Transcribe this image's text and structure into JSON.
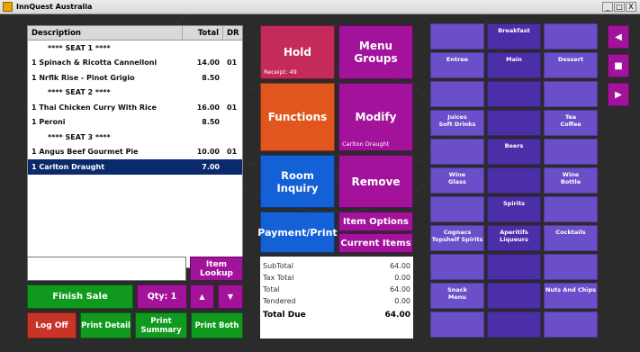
{
  "window": {
    "title": "InnQuest Australia",
    "controls": [
      "_",
      "□",
      "X"
    ]
  },
  "order": {
    "headers": {
      "description": "Description",
      "total": "Total",
      "dr": "DR"
    },
    "rows": [
      {
        "desc": "**** SEAT 1 ****",
        "total": "",
        "dr": "",
        "seat": true
      },
      {
        "desc": "1 Spinach & Ricotta Cannelloni",
        "total": "14.00",
        "dr": "01"
      },
      {
        "desc": "1 Nrflk Rise - Pinot Grigio",
        "total": "8.50",
        "dr": ""
      },
      {
        "desc": "**** SEAT 2 ****",
        "total": "",
        "dr": "",
        "seat": true
      },
      {
        "desc": "1 Thai Chicken Curry With Rice",
        "total": "16.00",
        "dr": "01"
      },
      {
        "desc": "1 Peroni",
        "total": "8.50",
        "dr": ""
      },
      {
        "desc": "**** SEAT 3 ****",
        "total": "",
        "dr": "",
        "seat": true
      },
      {
        "desc": "1 Angus Beef Gourmet Pie",
        "total": "10.00",
        "dr": "01"
      },
      {
        "desc": "1 Carlton Draught",
        "total": "7.00",
        "dr": "",
        "selected": true
      }
    ]
  },
  "input": {
    "value": ""
  },
  "buttons": {
    "item_lookup": "Item Lookup",
    "finish_sale": "Finish Sale",
    "qty": "Qty: 1",
    "up": "▲",
    "down": "▼",
    "log_off": "Log Off",
    "print_detail": "Print Detail",
    "print_summary": "Print\nSummary",
    "print_both": "Print Both",
    "hold": "Hold",
    "receipt": "Receipt: 49",
    "menu_groups": "Menu Groups",
    "functions": "Functions",
    "modify": "Modify",
    "modify_sub": "Carlton Draught",
    "room_inquiry": "Room Inquiry",
    "remove": "Remove",
    "payment_print": "Payment/Print",
    "item_options": "Item Options",
    "current_items": "Current Items"
  },
  "totals": {
    "subtotal_label": "SubTotal",
    "subtotal": "64.00",
    "tax_label": "Tax Total",
    "tax": "0.00",
    "total_label": "Total",
    "total": "64.00",
    "tendered_label": "Tendered",
    "tendered": "0.00",
    "due_label": "Total Due",
    "due": "64.00"
  },
  "grid_items": [
    {
      "label": "",
      "col": 0,
      "row": 0,
      "shade": "light"
    },
    {
      "label": "Breakfast",
      "col": 1,
      "row": 0,
      "shade": "dark"
    },
    {
      "label": "",
      "col": 2,
      "row": 0,
      "shade": "light"
    },
    {
      "label": "Entree",
      "col": 0,
      "row": 1,
      "shade": "light"
    },
    {
      "label": "Main",
      "col": 1,
      "row": 1,
      "shade": "dark"
    },
    {
      "label": "Dessert",
      "col": 2,
      "row": 1,
      "shade": "light"
    },
    {
      "label": "",
      "col": 0,
      "row": 2,
      "shade": "light"
    },
    {
      "label": "",
      "col": 1,
      "row": 2,
      "shade": "dark"
    },
    {
      "label": "",
      "col": 2,
      "row": 2,
      "shade": "light"
    },
    {
      "label": "Juices\nSoft Drinks",
      "col": 0,
      "row": 3,
      "shade": "light"
    },
    {
      "label": "",
      "col": 1,
      "row": 3,
      "shade": "dark"
    },
    {
      "label": "Tea\nCoffee",
      "col": 2,
      "row": 3,
      "shade": "light"
    },
    {
      "label": "",
      "col": 0,
      "row": 4,
      "shade": "light"
    },
    {
      "label": "Beers",
      "col": 1,
      "row": 4,
      "shade": "dark"
    },
    {
      "label": "",
      "col": 2,
      "row": 4,
      "shade": "light"
    },
    {
      "label": "Wine\nGlass",
      "col": 0,
      "row": 5,
      "shade": "light"
    },
    {
      "label": "",
      "col": 1,
      "row": 5,
      "shade": "dark"
    },
    {
      "label": "Wine\nBottle",
      "col": 2,
      "row": 5,
      "shade": "light"
    },
    {
      "label": "",
      "col": 0,
      "row": 6,
      "shade": "light"
    },
    {
      "label": "Spirits",
      "col": 1,
      "row": 6,
      "shade": "dark"
    },
    {
      "label": "",
      "col": 2,
      "row": 6,
      "shade": "light"
    },
    {
      "label": "Cognacs\nTopshelf Spirits",
      "col": 0,
      "row": 7,
      "shade": "light"
    },
    {
      "label": "Aperitifs\nLiqueurs",
      "col": 1,
      "row": 7,
      "shade": "dark"
    },
    {
      "label": "Cocktails",
      "col": 2,
      "row": 7,
      "shade": "light"
    },
    {
      "label": "",
      "col": 0,
      "row": 8,
      "shade": "light"
    },
    {
      "label": "",
      "col": 1,
      "row": 8,
      "shade": "dark"
    },
    {
      "label": "",
      "col": 2,
      "row": 8,
      "shade": "light"
    },
    {
      "label": "Snack\nMenu",
      "col": 0,
      "row": 9,
      "shade": "light"
    },
    {
      "label": "",
      "col": 1,
      "row": 9,
      "shade": "dark"
    },
    {
      "label": "Nuts And Chips",
      "col": 2,
      "row": 9,
      "shade": "light"
    },
    {
      "label": "",
      "col": 0,
      "row": 10,
      "shade": "light"
    },
    {
      "label": "",
      "col": 1,
      "row": 10,
      "shade": "dark"
    },
    {
      "label": "",
      "col": 2,
      "row": 10,
      "shade": "light"
    }
  ],
  "nav": {
    "prev": "◀",
    "stop": "■",
    "next": "▶"
  },
  "colors": {
    "green": "#0f9a1e",
    "magenta": "#a3129b",
    "red": "#c83427",
    "hold": "#c42a5a",
    "functions": "#e0561e",
    "blue": "#1460d6",
    "grid_light": "#6b4ec9",
    "grid_dark": "#4c2fa8"
  }
}
